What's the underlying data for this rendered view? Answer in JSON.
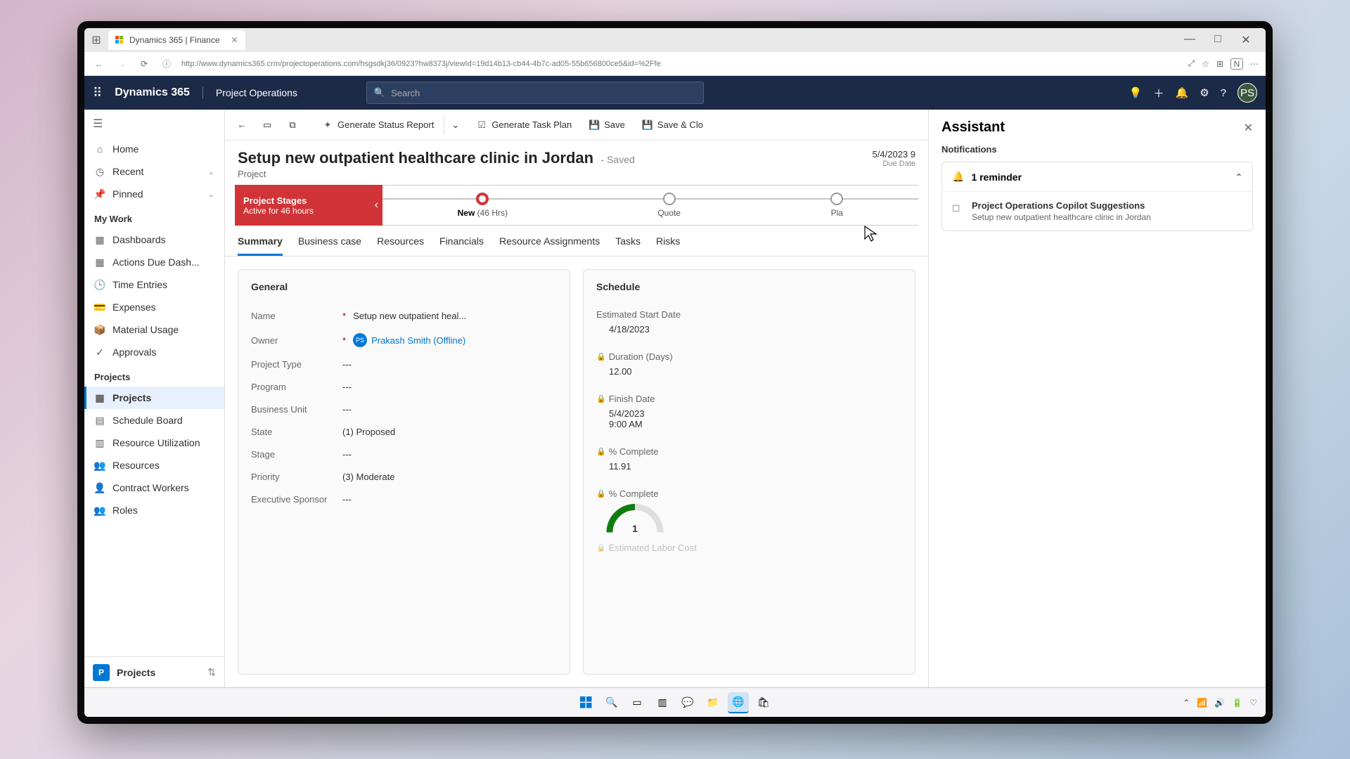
{
  "browser": {
    "tab_title": "Dynamics 365 | Finance",
    "url": "http://www.dynamics365.crm/projectoperations.com/hsgsdkj36/0923?hw8373j/viewId=19d14b13-cb44-4b7c-ad05-55b656800ce5&id=%2Ffe",
    "user_initial": "N"
  },
  "topbar": {
    "brand": "Dynamics 365",
    "module": "Project Operations",
    "search_placeholder": "Search",
    "avatar": "PS"
  },
  "sidebar": {
    "home": "Home",
    "recent": "Recent",
    "pinned": "Pinned",
    "section_mywork": "My Work",
    "dashboards": "Dashboards",
    "actions_due": "Actions Due Dash...",
    "time_entries": "Time Entries",
    "expenses": "Expenses",
    "material_usage": "Material Usage",
    "approvals": "Approvals",
    "section_projects": "Projects",
    "projects": "Projects",
    "schedule_board": "Schedule Board",
    "resource_util": "Resource Utilization",
    "resources": "Resources",
    "contract_workers": "Contract Workers",
    "roles": "Roles",
    "footer_label": "Projects",
    "footer_tile": "P"
  },
  "commandbar": {
    "generate_report": "Generate Status Report",
    "generate_task_plan": "Generate Task Plan",
    "save": "Save",
    "save_close": "Save & Clo"
  },
  "header": {
    "title": "Setup new outpatient healthcare clinic in Jordan",
    "saved_indicator": "- Saved",
    "subtitle": "Project",
    "due_date_value": "5/4/2023 9",
    "due_date_label": "Due Date"
  },
  "stages": {
    "badge_title": "Project Stages",
    "badge_sub": "Active for 46 hours",
    "new": "New",
    "new_meta": "(46 Hrs)",
    "quote": "Quote",
    "plan": "Pla"
  },
  "tabs": {
    "summary": "Summary",
    "business_case": "Business case",
    "resources": "Resources",
    "financials": "Financials",
    "resource_assign": "Resource Assignments",
    "tasks": "Tasks",
    "risks": "Risks"
  },
  "general": {
    "section": "General",
    "name_label": "Name",
    "name_value": "Setup new outpatient heal...",
    "owner_label": "Owner",
    "owner_value": "Prakash Smith (Offline)",
    "owner_initials": "PS",
    "project_type_label": "Project Type",
    "project_type_value": "---",
    "program_label": "Program",
    "program_value": "---",
    "business_unit_label": "Business Unit",
    "business_unit_value": "---",
    "state_label": "State",
    "state_value": "(1) Proposed",
    "stage_label": "Stage",
    "stage_value": "---",
    "priority_label": "Priority",
    "priority_value": "(3) Moderate",
    "exec_sponsor_label": "Executive Sponsor",
    "exec_sponsor_value": "---"
  },
  "schedule": {
    "section": "Schedule",
    "est_start_label": "Estimated Start Date",
    "est_start_value": "4/18/2023",
    "duration_label": "Duration (Days)",
    "duration_value": "12.00",
    "finish_label": "Finish Date",
    "finish_value": "5/4/2023",
    "finish_time": "9:00 AM",
    "pct1_label": "% Complete",
    "pct1_value": "11.91",
    "pct2_label": "% Complete",
    "gauge_value": "1",
    "labor_label": "Estimated Labor Cost"
  },
  "assistant": {
    "title": "Assistant",
    "section": "Notifications",
    "reminder_count": "1 reminder",
    "notif_title": "Project Operations Copilot Suggestions",
    "notif_sub": "Setup new outpatient healthcare clinic in Jordan"
  }
}
